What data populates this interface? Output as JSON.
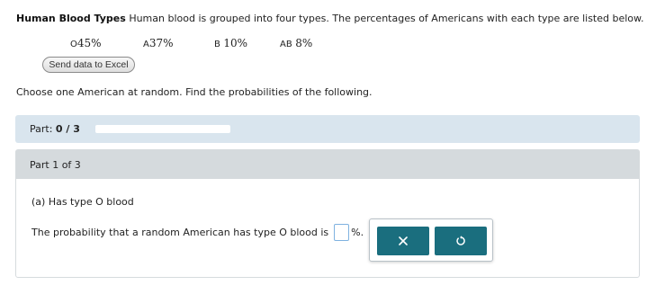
{
  "problem": {
    "title": "Human Blood Types",
    "text": "Human blood is grouped into four types. The percentages of Americans with each type are listed below."
  },
  "blood_types": [
    {
      "label": "O",
      "percent": "45%"
    },
    {
      "label": "A",
      "percent": "37%"
    },
    {
      "label": "B",
      "percent": "10%"
    },
    {
      "label": "AB",
      "percent": "8%"
    }
  ],
  "excel_button_label": "Send data to Excel",
  "prompt": "Choose one American at random. Find the probabilities of the following.",
  "progress": {
    "label": "Part:",
    "value": "0 / 3",
    "completed": 0,
    "total": 3,
    "fill_fraction": 0
  },
  "part": {
    "header": "Part 1 of 3",
    "question": "(a) Has type O blood",
    "answer_prefix": "The probability that a random American has type O blood is",
    "answer_value": "",
    "answer_suffix": "%."
  },
  "toolbox": {
    "clear_icon": "x-icon",
    "undo_icon": "undo-icon"
  },
  "colors": {
    "accent_button": "#1a6e7e",
    "progress_background": "#d9e5ee",
    "part_header_background": "#d5dadd",
    "input_border": "#7fb2e0"
  }
}
